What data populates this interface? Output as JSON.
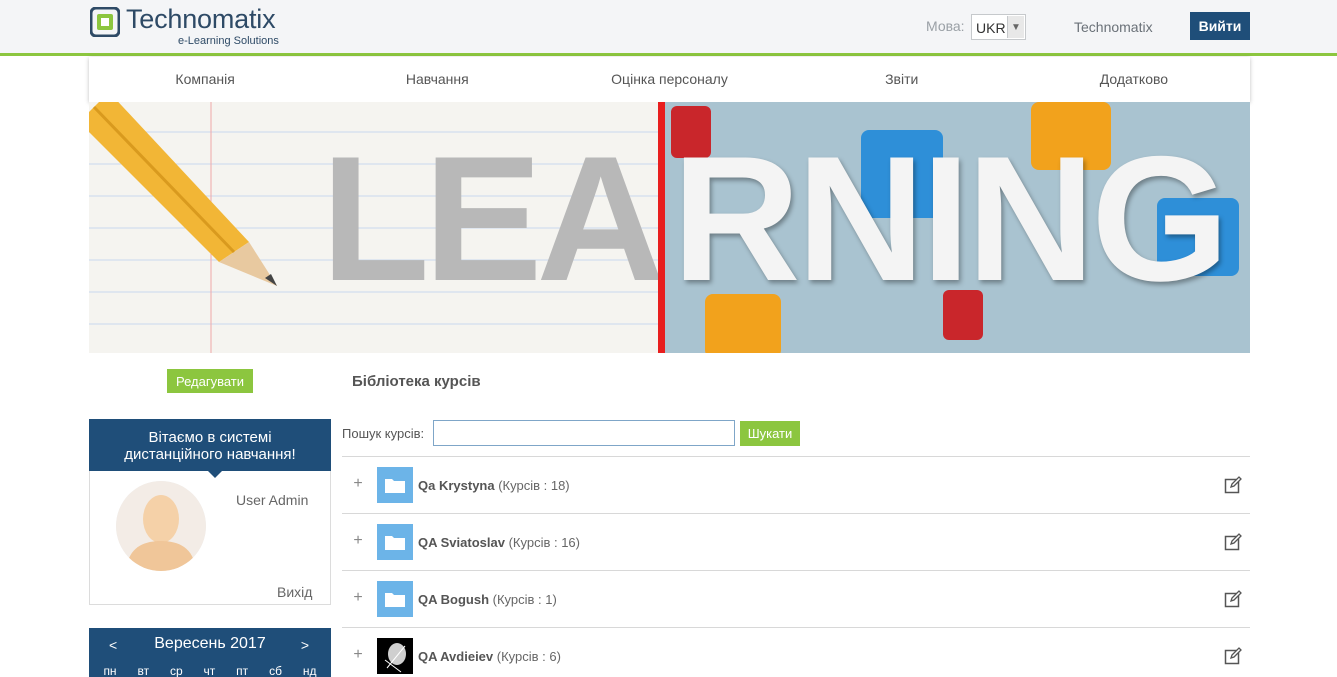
{
  "header": {
    "logo_text": "Technomatix",
    "logo_subtitle": "e-Learning Solutions",
    "lang_label": "Мова:",
    "lang_value": "UKR",
    "company_link": "Technomatix",
    "login_label": "Вийти"
  },
  "nav": {
    "items": [
      {
        "label": "Компанія"
      },
      {
        "label": "Навчання"
      },
      {
        "label": "Оцінка персоналу"
      },
      {
        "label": "Звіти"
      },
      {
        "label": "Додатково"
      }
    ]
  },
  "banner": {
    "left_text": "LEA",
    "right_text": "RNING"
  },
  "sidebar": {
    "edit_label": "Редагувати",
    "welcome_line1": "Вітаємо в системі",
    "welcome_line2": "дистанційного навчання!",
    "user_name": "User Admin",
    "logout_label": "Вихід",
    "calendar": {
      "prev": "<",
      "title": "Вересень 2017",
      "next": ">",
      "days": [
        "пн",
        "вт",
        "ср",
        "чт",
        "пт",
        "сб",
        "нд"
      ]
    }
  },
  "main": {
    "title": "Бібліотека курсів",
    "search_label": "Пошук курсів:",
    "search_value": "",
    "search_button": "Шукати",
    "folders": [
      {
        "name": "Qa Krystyna",
        "count": "(Курсів : 18)",
        "icon": "folder-icon"
      },
      {
        "name": "QA Sviatoslav",
        "count": "(Курсів : 16)",
        "icon": "folder-icon"
      },
      {
        "name": "QA Bogush",
        "count": "(Курсів : 1)",
        "icon": "folder-icon"
      },
      {
        "name": "QA Avdieiev",
        "count": "(Курсів : 6)",
        "icon": "thumbnail-image"
      }
    ]
  },
  "colors": {
    "brand_blue": "#1f4e79",
    "accent_green": "#8cc63f",
    "folder_blue": "#6cb4e8"
  }
}
